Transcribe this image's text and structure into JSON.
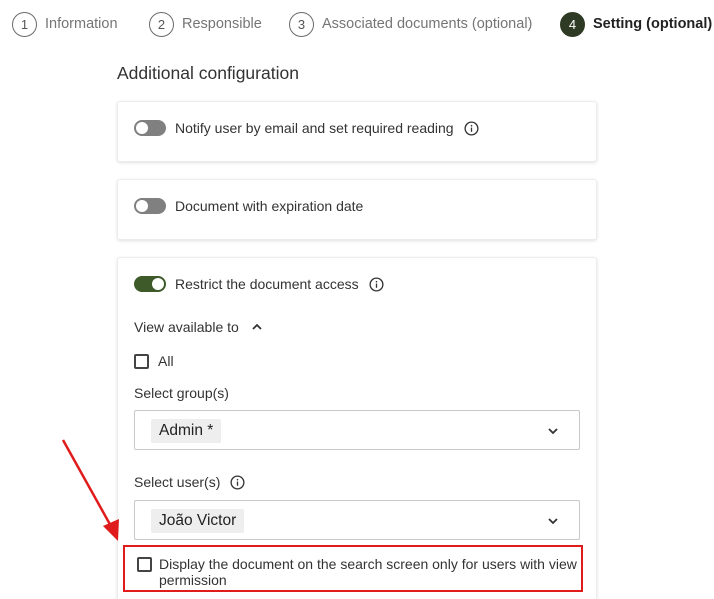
{
  "stepper": {
    "steps": [
      {
        "number": "1",
        "label": "Information"
      },
      {
        "number": "2",
        "label": "Responsible"
      },
      {
        "number": "3",
        "label": "Associated documents (optional)"
      },
      {
        "number": "4",
        "label": "Setting (optional)",
        "active": true
      }
    ]
  },
  "section_title": "Additional configuration",
  "options": {
    "notify": {
      "label": "Notify user by email and set required reading",
      "enabled": false
    },
    "expiration": {
      "label": "Document with expiration date",
      "enabled": false
    },
    "restrict": {
      "label": "Restrict the document access",
      "enabled": true
    }
  },
  "access": {
    "view_available_label": "View available to",
    "all_label": "All",
    "all_checked": false,
    "groups_label": "Select group(s)",
    "groups_selected": [
      "Admin *"
    ],
    "users_label": "Select user(s)",
    "users_selected": [
      "João Victor"
    ],
    "display_only_label": "Display the document on the search screen only for users with view permission",
    "display_only_checked": false
  },
  "colors": {
    "active_step": "#2f3a24",
    "toggle_on": "#3e5a29",
    "toggle_off": "#808080",
    "highlight_annotation": "#e01b1b"
  }
}
